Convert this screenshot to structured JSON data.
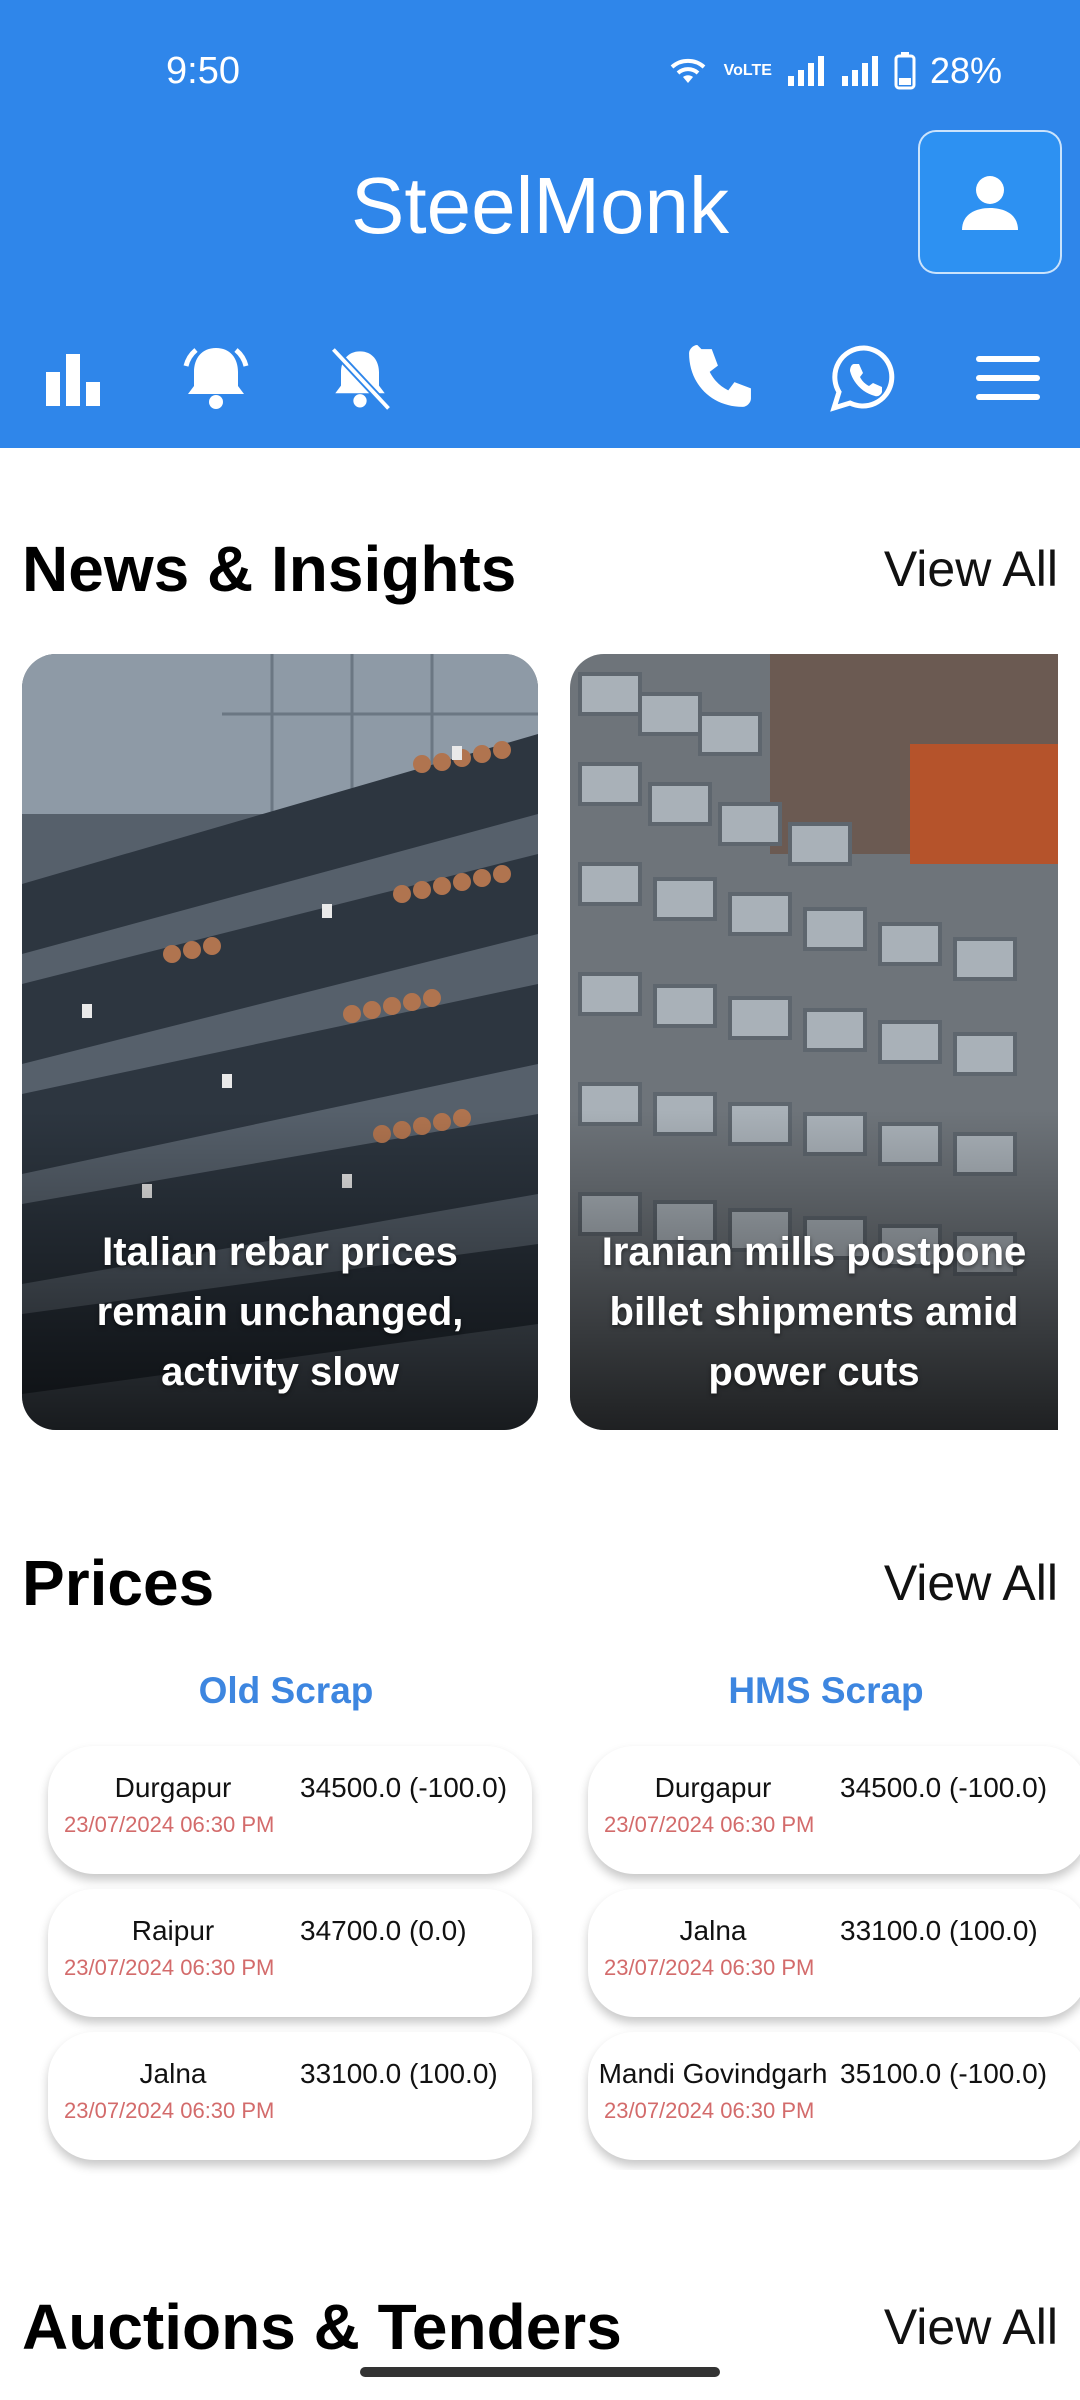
{
  "status_bar": {
    "time": "9:50",
    "battery": "28%",
    "network": "VoLTE"
  },
  "header": {
    "title": "SteelMonk",
    "background": "#2f86ea",
    "toolbar": [
      "bar-chart-icon",
      "alarm-icon",
      "notifications-off-icon",
      "phone-icon",
      "whatsapp-icon",
      "menu-icon"
    ]
  },
  "news": {
    "title": "News & Insights",
    "view_all": "View All",
    "cards": [
      {
        "caption": "Italian rebar prices remain unchanged, activity slow",
        "image": "rebar-stack"
      },
      {
        "caption": "Iranian mills postpone billet shipments amid power cuts",
        "image": "steel-billets"
      }
    ]
  },
  "prices": {
    "title": "Prices",
    "view_all": "View All",
    "columns": [
      {
        "title": "Old Scrap",
        "rows": [
          {
            "city": "Durgapur",
            "value": "34500.0 (-100.0)",
            "date": "23/07/2024 06:30 PM"
          },
          {
            "city": "Raipur",
            "value": "34700.0 (0.0)",
            "date": "23/07/2024 06:30 PM"
          },
          {
            "city": "Jalna",
            "value": "33100.0 (100.0)",
            "date": "23/07/2024 06:30 PM"
          }
        ]
      },
      {
        "title": "HMS Scrap",
        "rows": [
          {
            "city": "Durgapur",
            "value": "34500.0 (-100.0)",
            "date": "23/07/2024 06:30 PM"
          },
          {
            "city": "Jalna",
            "value": "33100.0 (100.0)",
            "date": "23/07/2024 06:30 PM"
          },
          {
            "city": "Mandi Govindgarh",
            "value": "35100.0 (-100.0)",
            "date": "23/07/2024 06:30 PM"
          }
        ]
      }
    ]
  },
  "auctions": {
    "title": "Auctions & Tenders",
    "view_all": "View All"
  }
}
